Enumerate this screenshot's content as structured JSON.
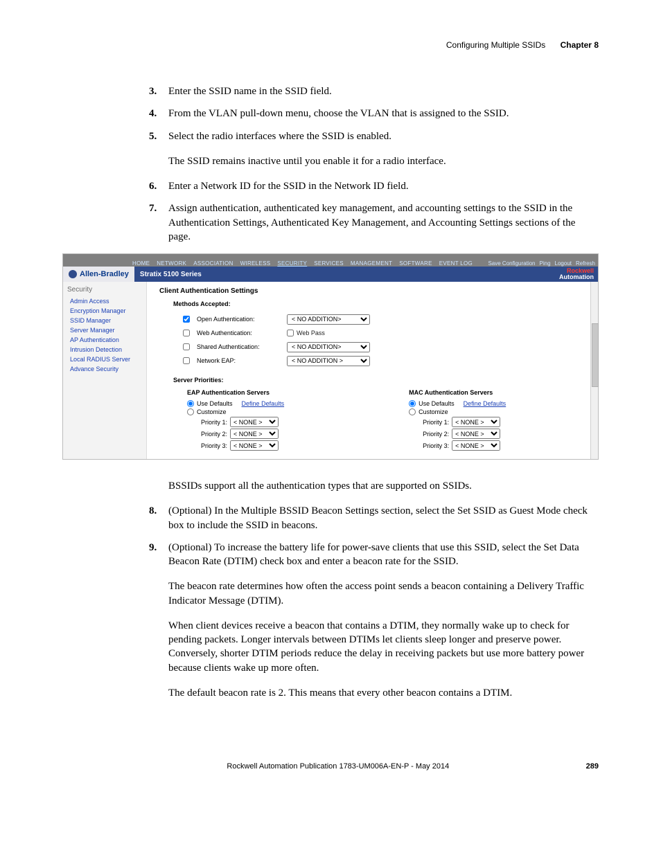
{
  "header": {
    "title": "Configuring Multiple SSIDs",
    "chapter": "Chapter 8"
  },
  "steps_a": [
    {
      "num": "3.",
      "text": "Enter the SSID name in the SSID field."
    },
    {
      "num": "4.",
      "text": "From the VLAN pull-down menu, choose the VLAN that is assigned to the SSID."
    },
    {
      "num": "5.",
      "text": "Select the radio interfaces where the SSID is enabled."
    }
  ],
  "para_after5": "The SSID remains inactive until you enable it for a radio interface.",
  "steps_b": [
    {
      "num": "6.",
      "text": "Enter a Network ID for the SSID in the Network ID field."
    },
    {
      "num": "7.",
      "text": "Assign authentication, authenticated key management, and accounting settings to the SSID in the Authentication Settings, Authenticated Key Management, and Accounting Settings sections of the page."
    }
  ],
  "shot": {
    "nav": [
      "HOME",
      "NETWORK",
      "ASSOCIATION",
      "WIRELESS",
      "SECURITY",
      "SERVICES",
      "MANAGEMENT",
      "SOFTWARE",
      "EVENT LOG"
    ],
    "toplinks": [
      "Save Configuration",
      "Ping",
      "Logout",
      "Refresh"
    ],
    "brand": "Allen-Bradley",
    "title": "Stratix 5100 Series",
    "rockwell1": "Rockwell",
    "rockwell2": "Automation",
    "side_header": "Security",
    "side_links": [
      "Admin Access",
      "Encryption Manager",
      "SSID Manager",
      "Server Manager",
      "AP Authentication",
      "Intrusion Detection",
      "Local RADIUS Server",
      "Advance Security"
    ],
    "sec_title": "Client Authentication Settings",
    "methods_label": "Methods Accepted:",
    "auth": {
      "open": "Open Authentication:",
      "web": "Web Authentication:",
      "webpass": "Web Pass",
      "shared": "Shared Authentication:",
      "eap": "Network EAP:",
      "no_addition": "< NO ADDITION>",
      "no_addition2": "< NO ADDITION >"
    },
    "server_priorities": "Server Priorities:",
    "eap_servers": "EAP Authentication Servers",
    "mac_servers": "MAC Authentication Servers",
    "use_defaults": "Use Defaults",
    "define_defaults": "Define Defaults",
    "customize": "Customize",
    "p1": "Priority 1:",
    "p2": "Priority 2:",
    "p3": "Priority 3:",
    "none": "< NONE >"
  },
  "para_bssid": "BSSIDs support all the authentication types that are supported on SSIDs.",
  "steps_c": [
    {
      "num": "8.",
      "text": "(Optional) In the Multiple BSSID Beacon Settings section, select the Set SSID as Guest Mode check box to include the SSID in beacons."
    },
    {
      "num": "9.",
      "text": "(Optional) To increase the battery life for power-save clients that use this SSID, select the Set Data Beacon Rate (DTIM) check box and enter a beacon rate for the SSID."
    }
  ],
  "para_beacon1": "The beacon rate determines how often the access point sends a beacon containing a Delivery Traffic Indicator Message (DTIM).",
  "para_beacon2": "When client devices receive a beacon that contains a DTIM, they normally wake up to check for pending packets. Longer intervals between DTIMs let clients sleep longer and preserve power. Conversely, shorter DTIM periods reduce the delay in receiving packets but use more battery power because clients wake up more often.",
  "para_beacon3": "The default beacon rate is 2. This means that every other beacon contains a DTIM.",
  "footer": {
    "pub": "Rockwell Automation Publication 1783-UM006A-EN-P - May 2014",
    "page": "289"
  }
}
